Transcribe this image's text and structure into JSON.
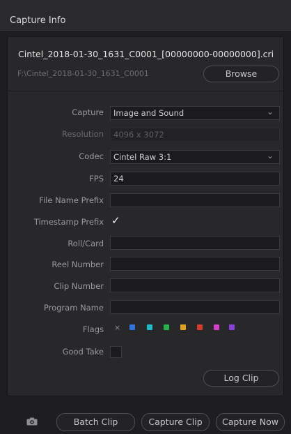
{
  "window": {
    "title": "Capture Info"
  },
  "file": {
    "name": "Cintel_2018-01-30_1631_C0001_[00000000-00000000].cri",
    "path": "F:\\Cintel_2018-01-30_1631_C0001",
    "browse_label": "Browse"
  },
  "fields": {
    "capture": {
      "label": "Capture",
      "value": "Image and Sound"
    },
    "resolution": {
      "label": "Resolution",
      "value": "4096 x 3072"
    },
    "codec": {
      "label": "Codec",
      "value": "Cintel Raw 3:1"
    },
    "fps": {
      "label": "FPS",
      "value": "24"
    },
    "file_name_prefix": {
      "label": "File Name Prefix",
      "value": ""
    },
    "timestamp_prefix": {
      "label": "Timestamp Prefix",
      "checked": true
    },
    "roll_card": {
      "label": "Roll/Card",
      "value": ""
    },
    "reel_number": {
      "label": "Reel Number",
      "value": ""
    },
    "clip_number": {
      "label": "Clip Number",
      "value": ""
    },
    "program_name": {
      "label": "Program Name",
      "value": ""
    },
    "flags": {
      "label": "Flags",
      "clear_symbol": "×",
      "colors": [
        "#2f74d6",
        "#20b8c8",
        "#23b34a",
        "#e0a020",
        "#d23a2a",
        "#d43fc8",
        "#8a3fd8"
      ]
    },
    "good_take": {
      "label": "Good Take",
      "checked": false
    }
  },
  "log_clip_label": "Log Clip",
  "bottom": {
    "camera_icon": "camera-icon",
    "batch_clip_label": "Batch Clip",
    "capture_clip_label": "Capture Clip",
    "capture_now_label": "Capture Now"
  }
}
